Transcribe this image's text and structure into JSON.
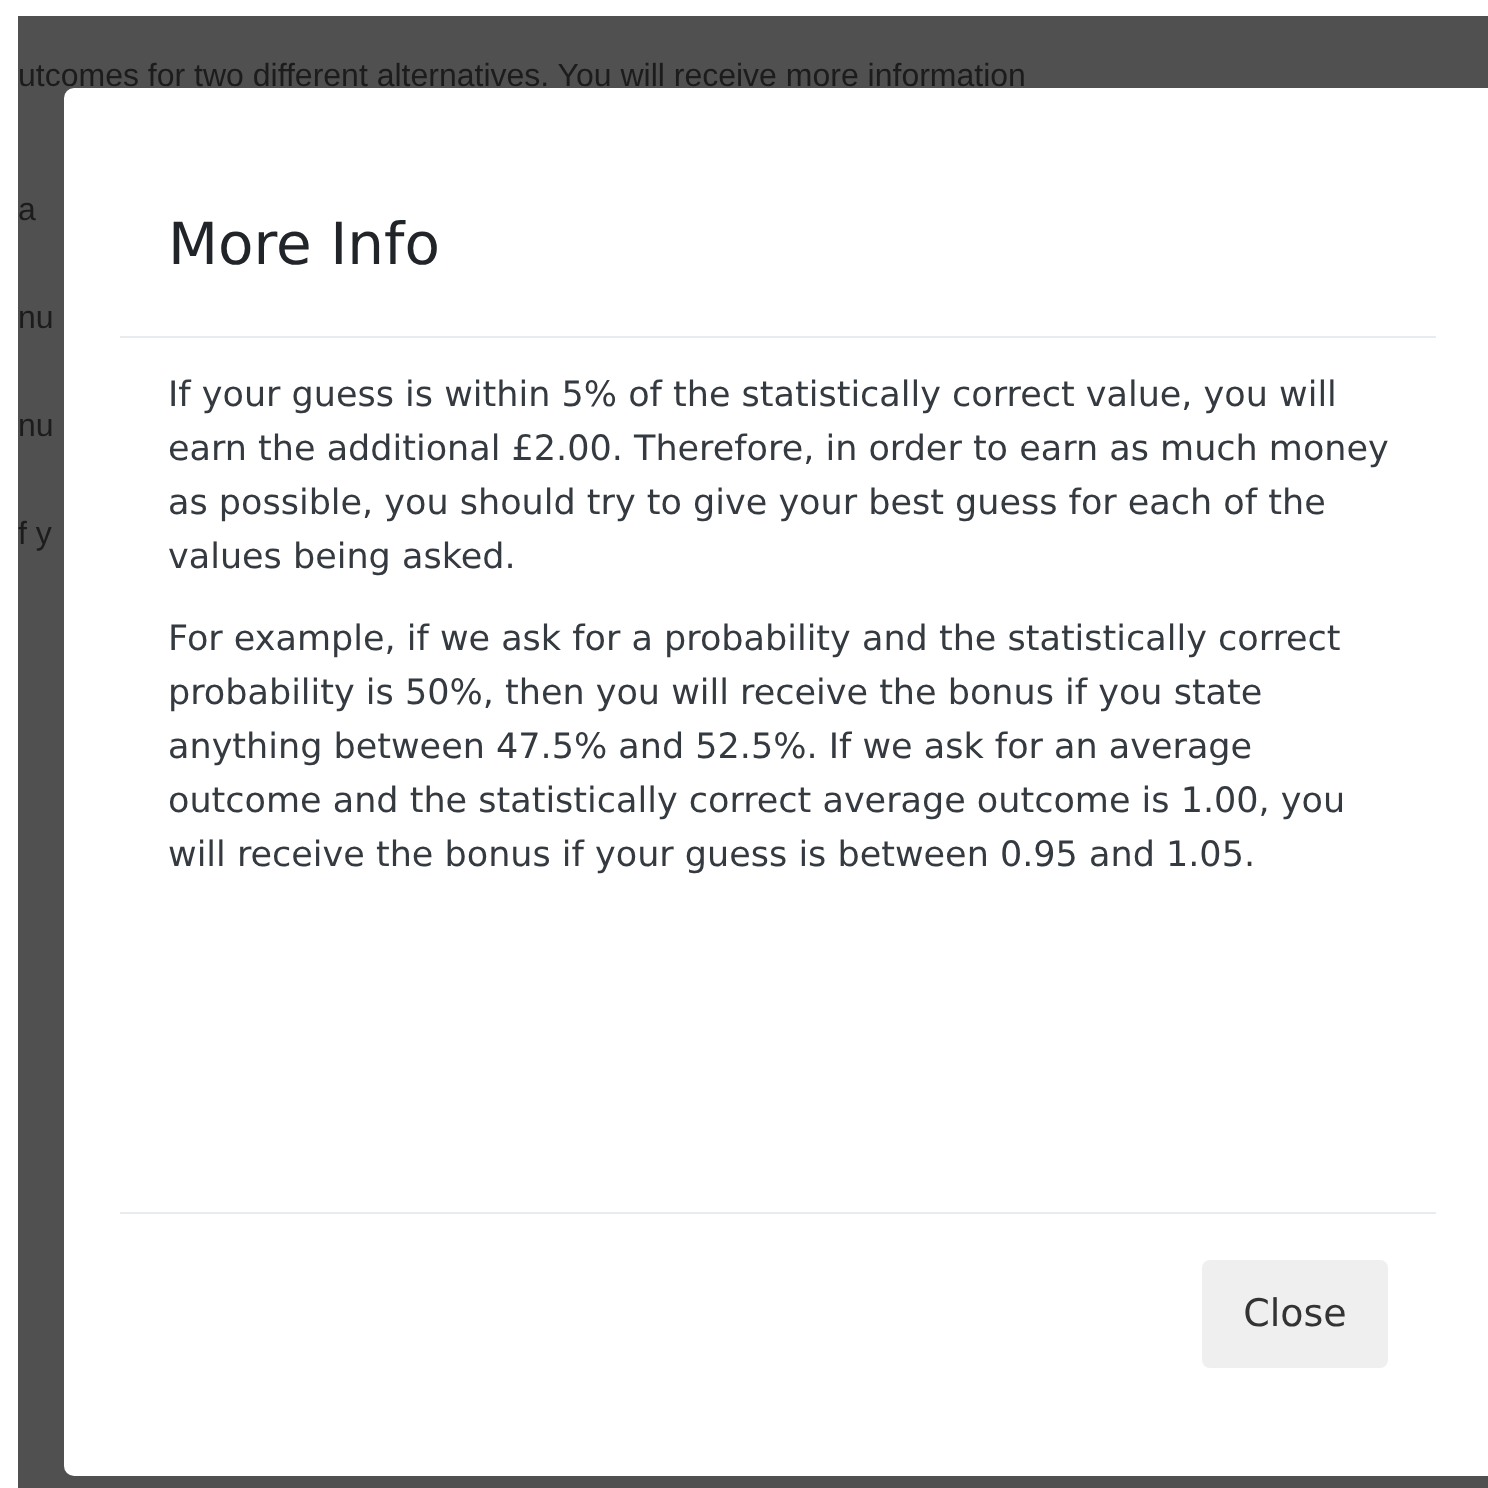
{
  "background": {
    "lines": [
      "utcomes for two different alternatives. You will receive more information",
      "a",
      "nu",
      "nu",
      "f y"
    ]
  },
  "modal": {
    "title": "More Info",
    "paragraphs": [
      "If your guess is within 5% of the statistically correct value, you will earn the additional £2.00. Therefore, in order to earn as much money as possible, you should try to give your best guess for each of the values being asked.",
      "For example, if we ask for a probability and the statistically correct probability is 50%, then you will receive the bonus if you state anything between 47.5% and 52.5%. If we ask for an average outcome and the statistically correct average outcome is 1.00, you will receive the bonus if your guess is between 0.95 and 1.05."
    ],
    "buttons": [
      "Close"
    ]
  }
}
